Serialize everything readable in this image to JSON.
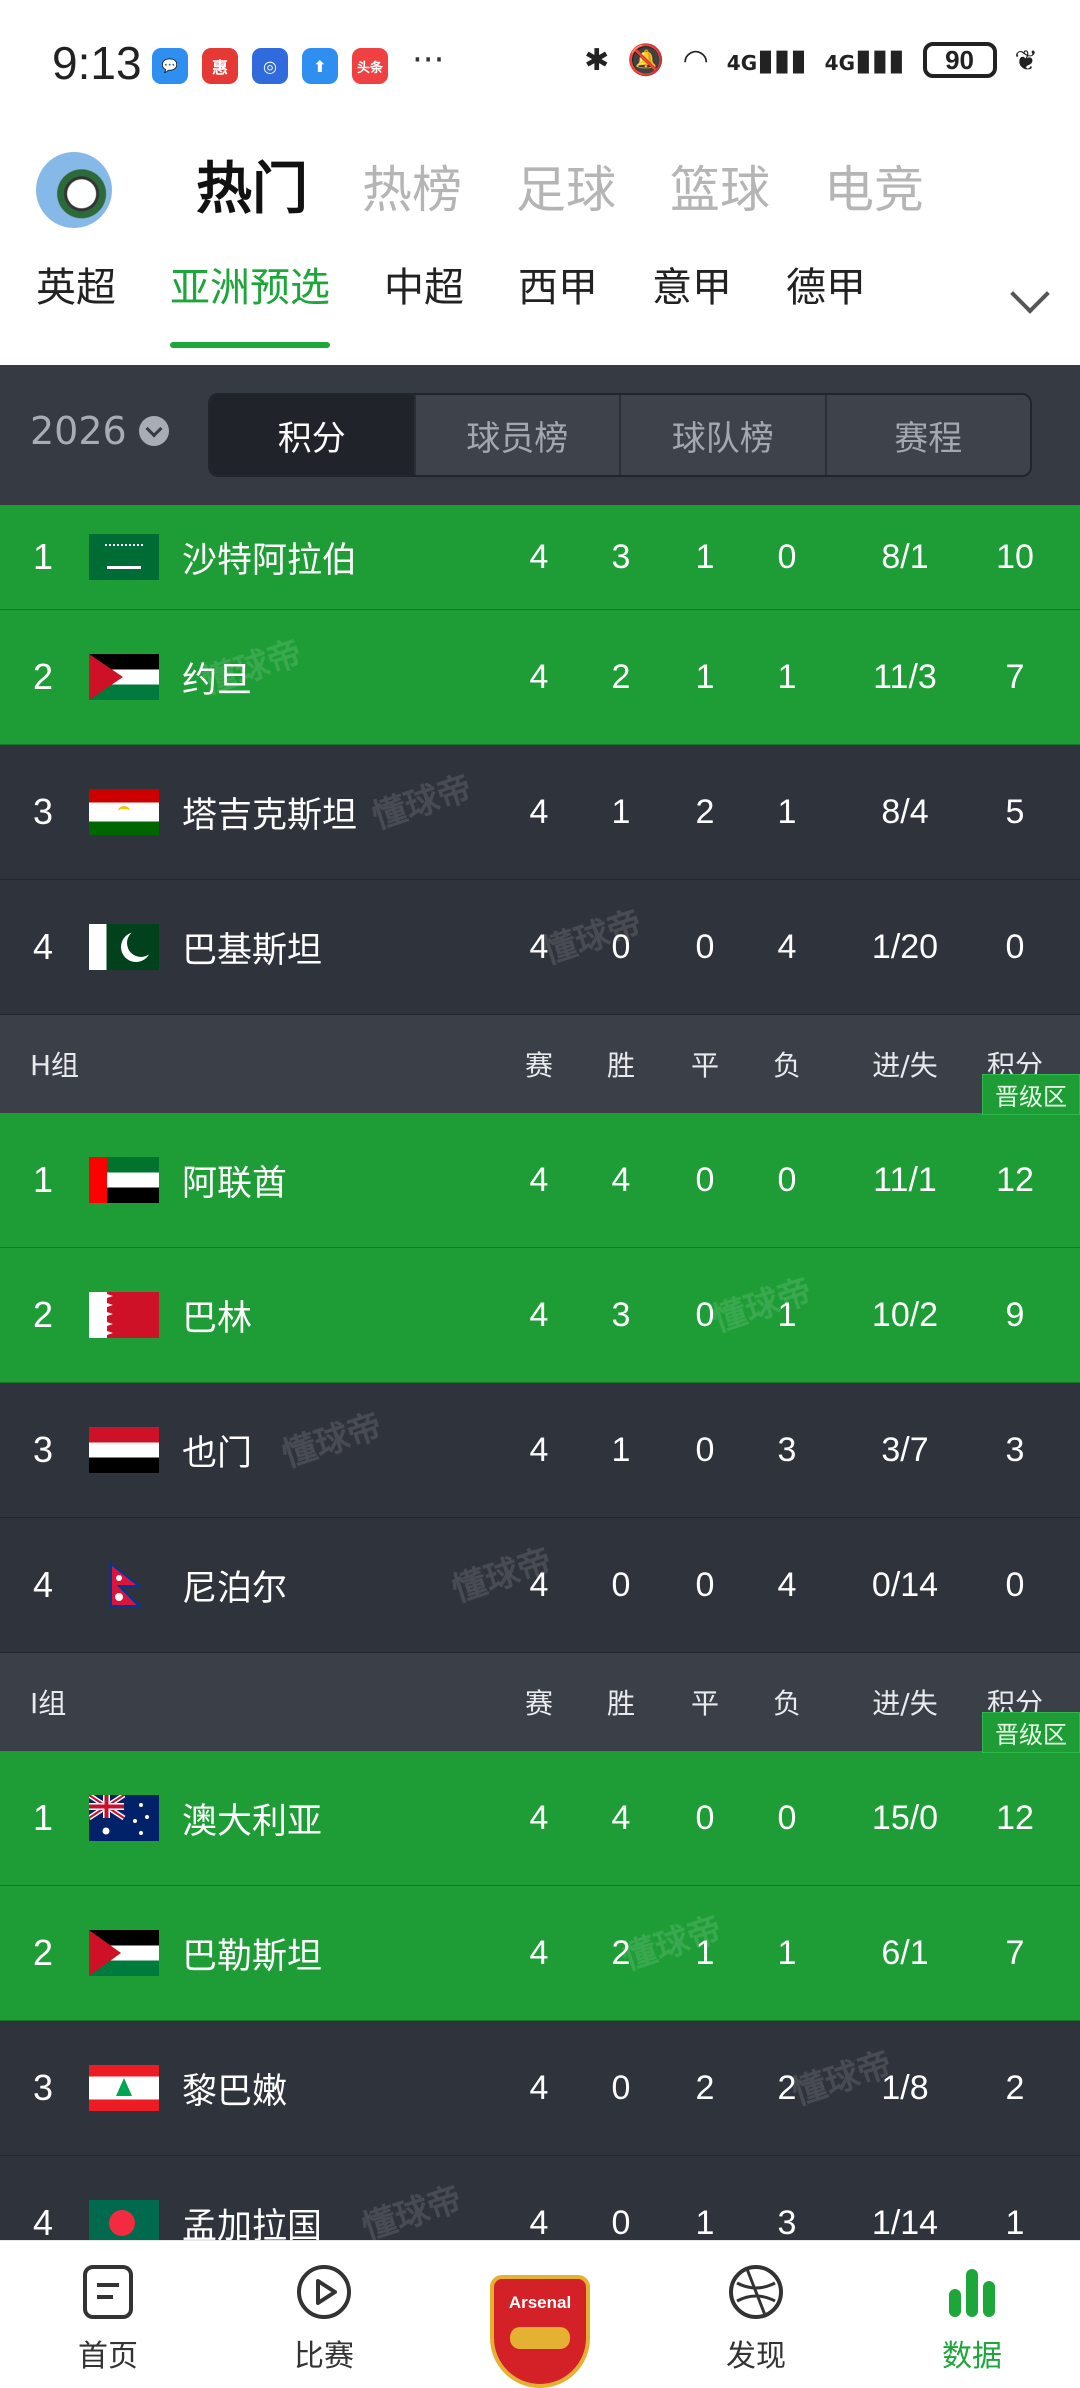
{
  "status_bar": {
    "time": "9:13",
    "apps": [
      {
        "icon": "message-app-icon",
        "glyph": "💬",
        "color": "#2f8ff0"
      },
      {
        "icon": "coupon-app-icon",
        "glyph": "惠",
        "color": "#e53935"
      },
      {
        "icon": "blue-app-icon",
        "glyph": "◎",
        "color": "#2f6bdc"
      },
      {
        "icon": "upload-app-icon",
        "glyph": "⬆",
        "color": "#2f8ff0"
      },
      {
        "icon": "toutiao-app-icon",
        "glyph": "头条",
        "color": "#f04142"
      }
    ],
    "more": "···",
    "network": "4G",
    "network2": "4G",
    "battery": "90"
  },
  "header": {
    "top_tabs": [
      "热门",
      "热榜",
      "足球",
      "篮球",
      "电竞"
    ],
    "active_top_tab": 0,
    "leagues": [
      "英超",
      "亚洲预选",
      "中超",
      "西甲",
      "意甲",
      "德甲"
    ],
    "active_league": 1
  },
  "toolbar": {
    "year": "2026",
    "tabs": [
      "积分",
      "球员榜",
      "球队榜",
      "赛程"
    ],
    "active_tab": 0
  },
  "qualified_label": "晋级区",
  "columns": {
    "played": "赛",
    "won": "胜",
    "drawn": "平",
    "lost": "负",
    "goals": "进/失",
    "points": "积分"
  },
  "groups": [
    {
      "name": "",
      "show_header": false,
      "rows": [
        {
          "rank": "1",
          "flag": "saudi",
          "team": "沙特阿拉伯",
          "played": "4",
          "won": "3",
          "drawn": "1",
          "lost": "0",
          "goals": "8/1",
          "points": "10",
          "qualified": true
        },
        {
          "rank": "2",
          "flag": "jordan",
          "team": "约旦",
          "played": "4",
          "won": "2",
          "drawn": "1",
          "lost": "1",
          "goals": "11/3",
          "points": "7",
          "qualified": true
        },
        {
          "rank": "3",
          "flag": "tajikistan",
          "team": "塔吉克斯坦",
          "played": "4",
          "won": "1",
          "drawn": "2",
          "lost": "1",
          "goals": "8/4",
          "points": "5",
          "qualified": false
        },
        {
          "rank": "4",
          "flag": "pakistan",
          "team": "巴基斯坦",
          "played": "4",
          "won": "0",
          "drawn": "0",
          "lost": "4",
          "goals": "1/20",
          "points": "0",
          "qualified": false
        }
      ]
    },
    {
      "name": "H组",
      "show_header": true,
      "rows": [
        {
          "rank": "1",
          "flag": "uae",
          "team": "阿联酋",
          "played": "4",
          "won": "4",
          "drawn": "0",
          "lost": "0",
          "goals": "11/1",
          "points": "12",
          "qualified": true
        },
        {
          "rank": "2",
          "flag": "bahrain",
          "team": "巴林",
          "played": "4",
          "won": "3",
          "drawn": "0",
          "lost": "1",
          "goals": "10/2",
          "points": "9",
          "qualified": true
        },
        {
          "rank": "3",
          "flag": "yemen",
          "team": "也门",
          "played": "4",
          "won": "1",
          "drawn": "0",
          "lost": "3",
          "goals": "3/7",
          "points": "3",
          "qualified": false
        },
        {
          "rank": "4",
          "flag": "nepal",
          "team": "尼泊尔",
          "played": "4",
          "won": "0",
          "drawn": "0",
          "lost": "4",
          "goals": "0/14",
          "points": "0",
          "qualified": false
        }
      ]
    },
    {
      "name": "I组",
      "show_header": true,
      "rows": [
        {
          "rank": "1",
          "flag": "australia",
          "team": "澳大利亚",
          "played": "4",
          "won": "4",
          "drawn": "0",
          "lost": "0",
          "goals": "15/0",
          "points": "12",
          "qualified": true
        },
        {
          "rank": "2",
          "flag": "palestine",
          "team": "巴勒斯坦",
          "played": "4",
          "won": "2",
          "drawn": "1",
          "lost": "1",
          "goals": "6/1",
          "points": "7",
          "qualified": true
        },
        {
          "rank": "3",
          "flag": "lebanon",
          "team": "黎巴嫩",
          "played": "4",
          "won": "0",
          "drawn": "2",
          "lost": "2",
          "goals": "1/8",
          "points": "2",
          "qualified": false
        },
        {
          "rank": "4",
          "flag": "bangladesh",
          "team": "孟加拉国",
          "played": "4",
          "won": "0",
          "drawn": "1",
          "lost": "3",
          "goals": "1/14",
          "points": "1",
          "qualified": false
        }
      ]
    }
  ],
  "watermark": "懂球帝",
  "bottom_nav": [
    {
      "label": "首页",
      "icon": "home-icon"
    },
    {
      "label": "比赛",
      "icon": "play-icon"
    },
    {
      "label": "",
      "icon": "arsenal-crest-icon",
      "crest_text": "Arsenal"
    },
    {
      "label": "发现",
      "icon": "discover-icon"
    },
    {
      "label": "数据",
      "icon": "data-bars-icon",
      "active": true
    }
  ],
  "colors": {
    "accent": "#1da63a",
    "qualified_row": "#1e9d36",
    "normal_row": "#2f333b",
    "group_header": "#3a3f48"
  }
}
